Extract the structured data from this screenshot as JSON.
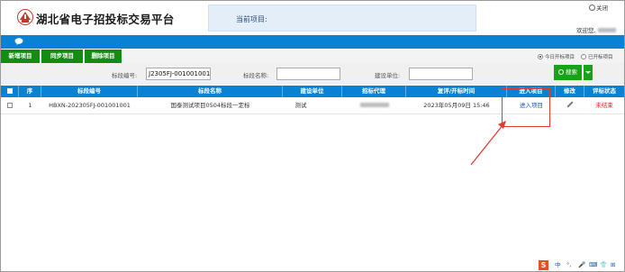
{
  "header": {
    "app_title": "湖北省电子招投标交易平台",
    "current_project_label": "当前项目:",
    "close_label": "关闭",
    "welcome_label": "欢迎您,"
  },
  "toolbar": {
    "buttons": [
      "新增项目",
      "同步项目",
      "删除项目"
    ],
    "radio_today": "今日开标项目",
    "radio_opened": "已开标项目",
    "radio_selected": "今日开标项目"
  },
  "search": {
    "section_code_label": "标段编号:",
    "section_code_value": "J2305FJ-001001001",
    "section_name_label": "标段名称:",
    "section_name_value": "",
    "builder_label": "建设单位:",
    "builder_value": "",
    "search_button": "搜索"
  },
  "table": {
    "columns": [
      "序",
      "标段编号",
      "标段名称",
      "建设单位",
      "招标代理",
      "复评/开标时间",
      "进入项目",
      "修改",
      "评标状态"
    ],
    "rows": [
      {
        "index": "1",
        "code": "HBXN-202305FJ-001001001",
        "name": "国泰测试项目0504标段一定标",
        "builder": "测试",
        "agent": "",
        "time": "2023年05月09日 15:46",
        "enter": "进入项目",
        "status": "未结束"
      }
    ]
  },
  "ime": {
    "items": [
      "中",
      "°,",
      "🎤",
      "⌨",
      "👕",
      "⊞"
    ]
  },
  "colors": {
    "brand_blue": "#0a82d4",
    "button_green": "#128c12",
    "annotation_red": "#e23b2e",
    "status_red": "#e02020"
  }
}
